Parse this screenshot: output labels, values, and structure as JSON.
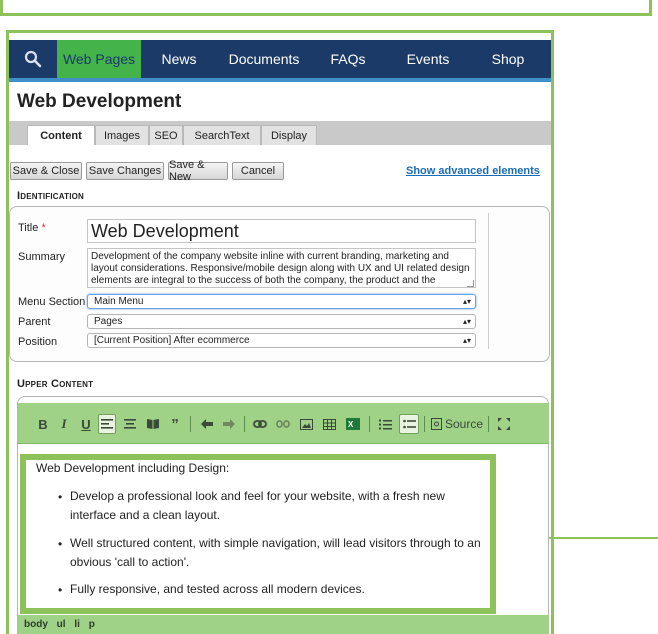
{
  "nav": {
    "search_icon": "search-icon",
    "items": [
      "Web Pages",
      "News",
      "Documents",
      "FAQs",
      "Events",
      "Shop"
    ],
    "active_index": 0
  },
  "page": {
    "title": "Web Development"
  },
  "tabs": [
    "Content",
    "Images",
    "SEO",
    "SearchText",
    "Display"
  ],
  "actions": {
    "save_close": "Save & Close",
    "save_changes": "Save Changes",
    "save_new": "Save & New",
    "cancel": "Cancel",
    "advanced": "Show advanced elements"
  },
  "identification": {
    "heading": "Identification",
    "title_label": "Title",
    "required_mark": "*",
    "title_value": "Web Development",
    "summary_label": "Summary",
    "summary_value": "Development of the company website inline with current branding, marketing and layout considerations. Responsive/mobile design along with UX and UI related design elements are integral to the success of both the company, the product and the website.",
    "menu_section_label": "Menu Section",
    "menu_section_value": "Main Menu",
    "parent_label": "Parent",
    "parent_value": "Pages",
    "position_label": "Position",
    "position_value": "[Current Position] After ecommerce"
  },
  "upper_content": {
    "heading": "Upper Content",
    "toolbar": {
      "bold": "B",
      "italic": "I",
      "underline": "U",
      "source": "Source"
    },
    "intro": "Web Development including Design:",
    "bullets": [
      "Develop a professional look and feel for your website, with a fresh new interface and a clean layout.",
      "Well structured content, with simple navigation, will lead visitors through to an obvious 'call to action'.",
      "Fully responsive, and tested across all modern devices."
    ],
    "path": [
      "body",
      "ul",
      "li",
      "p"
    ]
  },
  "colors": {
    "nav_bg": "#1b3a68",
    "nav_active": "#44b34a",
    "highlight_green": "#8dc25b",
    "toolbar_green": "#9fd186",
    "link_blue": "#1a6bb5"
  }
}
